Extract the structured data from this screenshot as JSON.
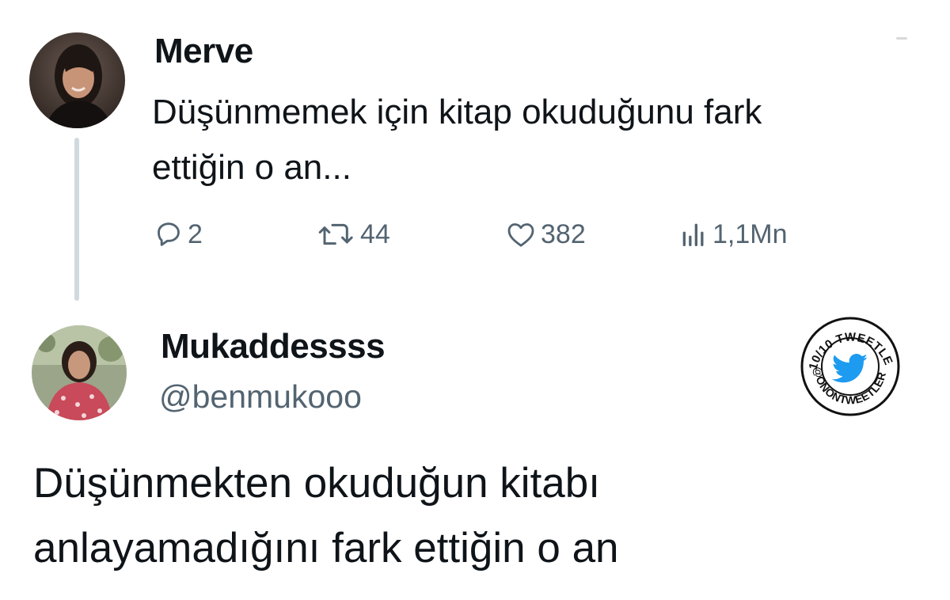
{
  "tweets": [
    {
      "author": "Merve",
      "text_lines": [
        "Düşünmemek için kitap okuduğunu fark",
        "ettiğin o an..."
      ],
      "stats": {
        "replies": "2",
        "retweets": "44",
        "likes": "382",
        "views": "1,1Mn"
      }
    },
    {
      "author": "Mukaddessss",
      "handle": "@benmukooo",
      "text_lines": [
        "Düşünmekten okuduğun kitabı",
        "anlayamadığını fark ettiğin o an"
      ]
    }
  ],
  "badge": {
    "top_text": "10/10 TWEETLER",
    "bottom_text": "@ONONTWEETLER",
    "icon": "twitter-bird-icon"
  },
  "colors": {
    "text": "#0f1419",
    "secondary": "#536471",
    "thread_line": "#cfd9de",
    "twitter_blue": "#1d9bf0"
  }
}
